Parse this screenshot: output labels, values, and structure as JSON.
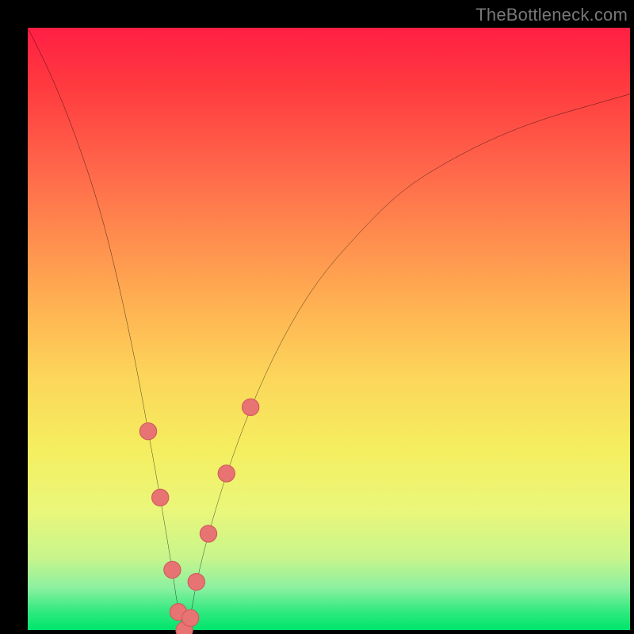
{
  "watermark": {
    "text": "TheBottleneck.com"
  },
  "colors": {
    "frame": "#000000",
    "curve_stroke": "#000000",
    "marker_fill": "#e87373",
    "marker_stroke": "#cf5c5c",
    "gradient_top": "#ff1f44",
    "gradient_bottom": "#00e56b"
  },
  "chart_data": {
    "type": "line",
    "title": "",
    "xlabel": "",
    "ylabel": "",
    "xlim": [
      0,
      100
    ],
    "ylim": [
      0,
      100
    ],
    "grid": false,
    "legend": false,
    "annotations": [],
    "series": [
      {
        "name": "bottleneck-curve",
        "x": [
          0,
          4,
          8,
          12,
          15,
          18,
          20,
          22,
          24,
          25,
          26,
          27,
          28,
          30,
          33,
          37,
          42,
          48,
          55,
          62,
          70,
          78,
          86,
          93,
          100
        ],
        "y": [
          100,
          92,
          82,
          70,
          58,
          44,
          33,
          22,
          10,
          3,
          0,
          2,
          8,
          16,
          26,
          37,
          48,
          58,
          66,
          73,
          78,
          82,
          85,
          87,
          89
        ],
        "markers": [
          0,
          0,
          0,
          0,
          0,
          0,
          1,
          1,
          1,
          1,
          1,
          1,
          1,
          1,
          1,
          1,
          0,
          0,
          0,
          0,
          0,
          0,
          0,
          0,
          0
        ]
      }
    ]
  }
}
